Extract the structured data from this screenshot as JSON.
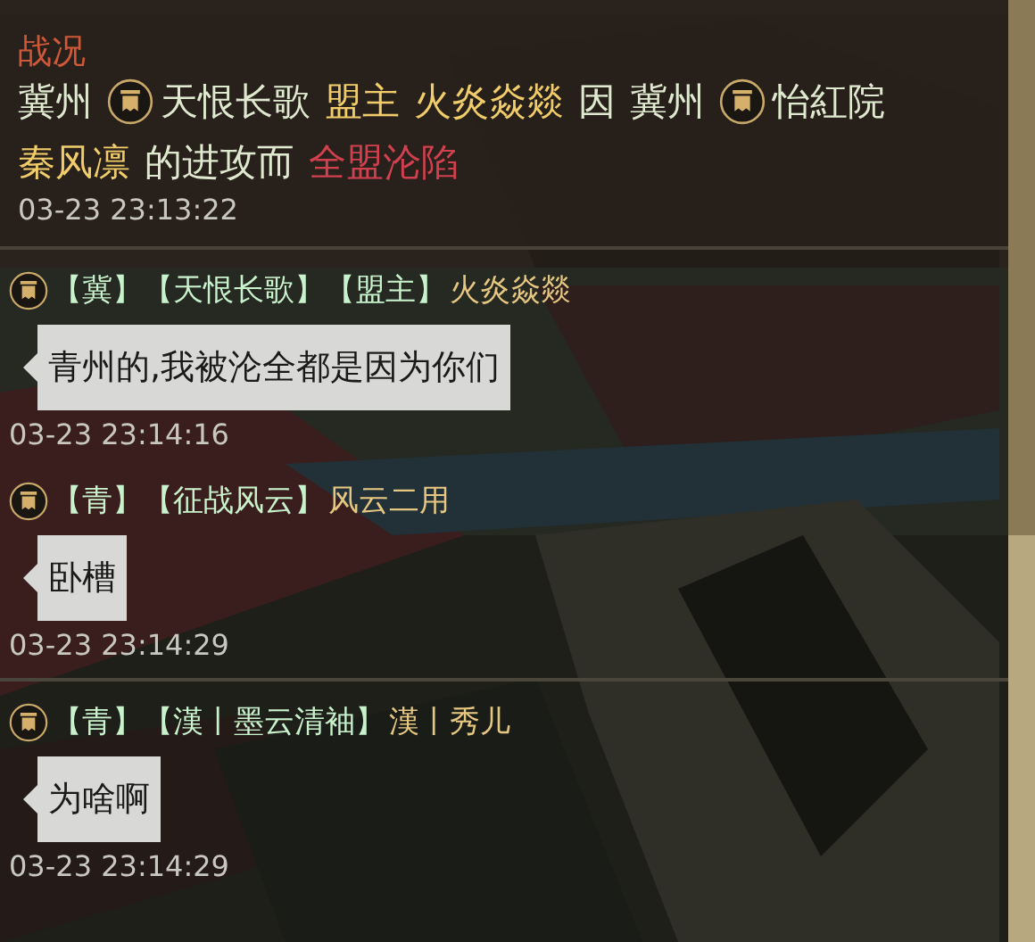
{
  "report": {
    "title": "战况",
    "segments": [
      {
        "kind": "plain",
        "text": "冀州"
      },
      {
        "kind": "emblem"
      },
      {
        "kind": "plain",
        "text": "天恨长歌"
      },
      {
        "kind": "gold",
        "text": "盟主"
      },
      {
        "kind": "gold",
        "text": "火炎焱燚"
      },
      {
        "kind": "plain",
        "text": "因"
      },
      {
        "kind": "plain",
        "text": "冀州"
      },
      {
        "kind": "emblem"
      },
      {
        "kind": "plain",
        "text": "怡紅院"
      },
      {
        "kind": "gold",
        "text": "秦风凛"
      },
      {
        "kind": "plain",
        "text": "的进攻而"
      },
      {
        "kind": "red",
        "text": "全盟沦陷"
      }
    ],
    "time": "03-23 23:13:22"
  },
  "messages": [
    {
      "tags": "【冀】【天恨长歌】【盟主】",
      "name": "火炎焱燚",
      "text": "青州的,我被沦全都是因为你们",
      "time": "03-23 23:14:16"
    },
    {
      "tags": "【青】【征战风云】",
      "name": "风云二用",
      "text": "卧槽",
      "time": "03-23 23:14:29"
    },
    {
      "tags": "【青】【漢丨墨云清袖】",
      "name": "漢丨秀儿",
      "text": "为啥啊",
      "time": "03-23 23:14:29"
    }
  ]
}
